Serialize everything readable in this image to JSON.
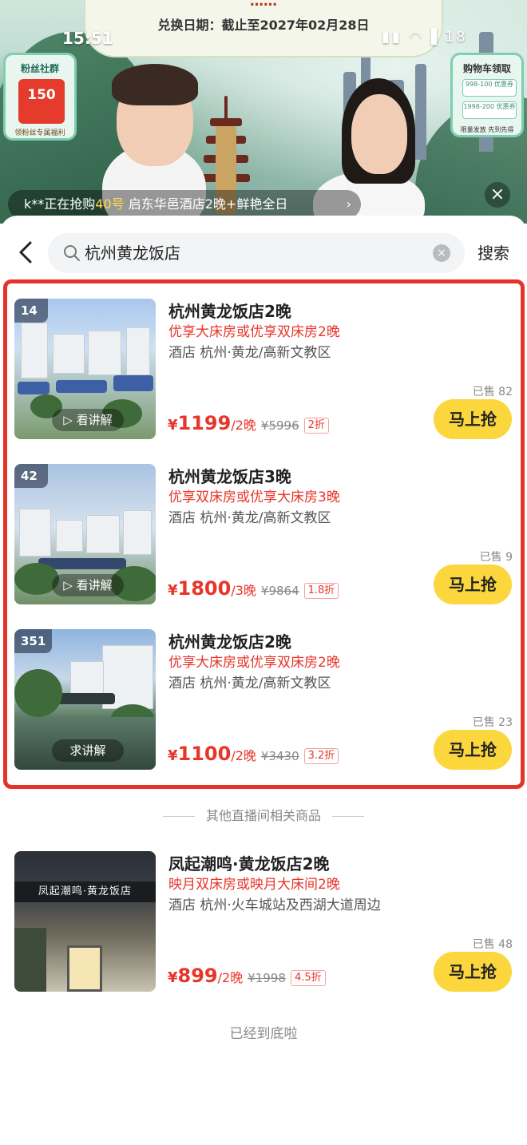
{
  "live": {
    "banner_title": "……",
    "banner_line": "兑换日期：截止至2027年02月28日",
    "status_time": "15:51",
    "status_battery": "18",
    "fans_title": "粉丝社群",
    "fans_amount": "150",
    "fans_sub": "领粉丝专属福利",
    "cart_title": "购物车领取",
    "cart_coupons": [
      "998-100 优惠券",
      "1998-200 优惠券"
    ],
    "cart_sub": "限量发放 先到先得",
    "ticker_prefix": "k**正在抢购",
    "ticker_num": "40号",
    "ticker_rest": " 启东华邑酒店2晚+鲜艳全日",
    "ticker_arrow": "›",
    "close_icon": "×"
  },
  "search": {
    "query": "杭州黄龙饭店",
    "clear_icon": "×",
    "button_label": "搜索"
  },
  "results": [
    {
      "rank": "14",
      "title": "杭州黄龙饭店2晚",
      "subtitle": "优享大床房或优享双床房2晚",
      "meta": "酒店 杭州·黄龙/高新文教区",
      "sold": "已售 82",
      "currency": "¥",
      "price": "1199",
      "unit": "/2晚",
      "original": "¥5996",
      "discount": "2折",
      "explain": "看讲解",
      "buy_label": "马上抢"
    },
    {
      "rank": "42",
      "title": "杭州黄龙饭店3晚",
      "subtitle": "优享双床房或优享大床房3晚",
      "meta": "酒店 杭州·黄龙/高新文教区",
      "sold": "已售 9",
      "currency": "¥",
      "price": "1800",
      "unit": "/3晚",
      "original": "¥9864",
      "discount": "1.8折",
      "explain": "看讲解",
      "buy_label": "马上抢"
    },
    {
      "rank": "351",
      "title": "杭州黄龙饭店2晚",
      "subtitle": "优享大床房或优享双床房2晚",
      "meta": "酒店 杭州·黄龙/高新文教区",
      "sold": "已售 23",
      "currency": "¥",
      "price": "1100",
      "unit": "/2晚",
      "original": "¥3430",
      "discount": "3.2折",
      "explain": "求讲解",
      "buy_label": "马上抢"
    }
  ],
  "other_section_label": "其他直播间相关商品",
  "other": {
    "title": "凤起潮鸣·黄龙饭店2晚",
    "subtitle": "映月双床房或映月大床间2晚",
    "meta": "酒店 杭州·火车城站及西湖大道周边",
    "sold": "已售 48",
    "currency": "¥",
    "price": "899",
    "unit": "/2晚",
    "original": "¥1998",
    "discount": "4.5折",
    "sign_text": "凤起潮鸣·黄龙饭店",
    "buy_label": "马上抢"
  },
  "end_text": "已经到底啦"
}
